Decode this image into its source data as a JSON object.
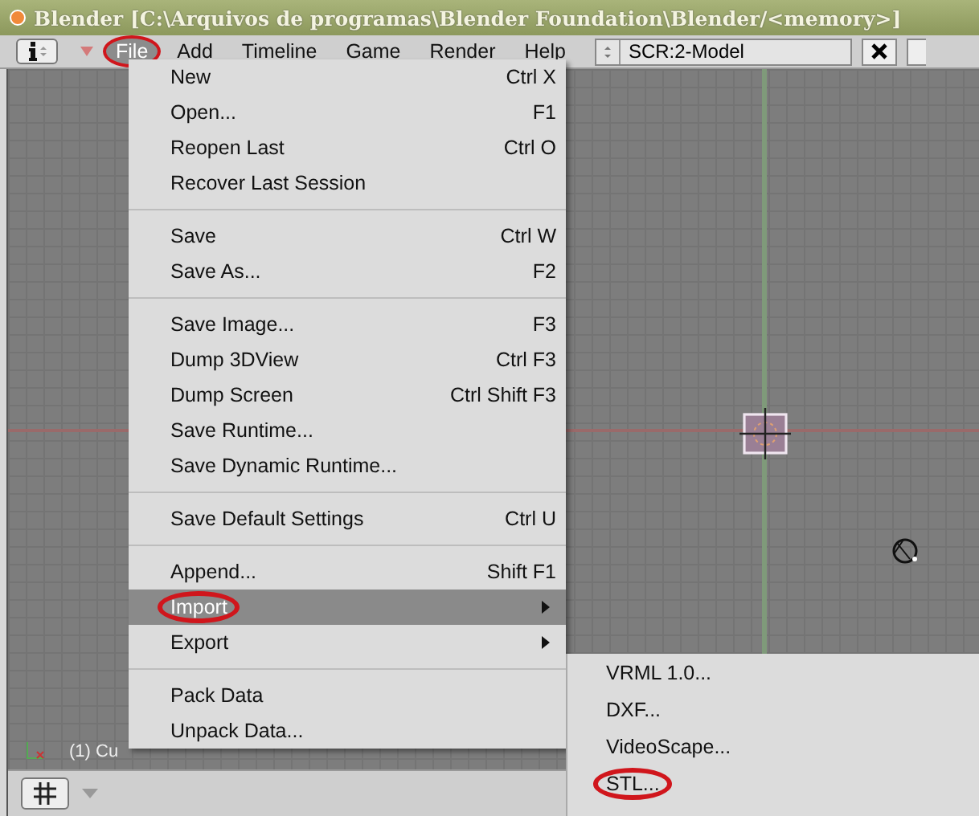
{
  "window": {
    "title": "Blender [C:\\Arquivos de programas\\Blender Foundation\\Blender/<memory>]"
  },
  "header": {
    "menus": [
      {
        "label": "File",
        "selected": true,
        "circled": true
      },
      {
        "label": "Add",
        "selected": false,
        "circled": false
      },
      {
        "label": "Timeline",
        "selected": false,
        "circled": false
      },
      {
        "label": "Game",
        "selected": false,
        "circled": false
      },
      {
        "label": "Render",
        "selected": false,
        "circled": false
      },
      {
        "label": "Help",
        "selected": false,
        "circled": false
      }
    ],
    "screen": "SCR:2-Model"
  },
  "viewport": {
    "object_label": "(1) Cu"
  },
  "file_menu": {
    "items": [
      {
        "kind": "item",
        "label": "New",
        "shortcut": "Ctrl X",
        "selected": false,
        "circled": false
      },
      {
        "kind": "item",
        "label": "Open...",
        "shortcut": "F1",
        "selected": false,
        "circled": false
      },
      {
        "kind": "item",
        "label": "Reopen Last",
        "shortcut": "Ctrl O",
        "selected": false,
        "circled": false
      },
      {
        "kind": "item",
        "label": "Recover Last Session",
        "selected": false,
        "circled": false
      },
      {
        "kind": "separator"
      },
      {
        "kind": "item",
        "label": "Save",
        "shortcut": "Ctrl W",
        "selected": false,
        "circled": false
      },
      {
        "kind": "item",
        "label": "Save As...",
        "shortcut": "F2",
        "selected": false,
        "circled": false
      },
      {
        "kind": "separator"
      },
      {
        "kind": "item",
        "label": "Save Image...",
        "shortcut": "F3",
        "selected": false,
        "circled": false
      },
      {
        "kind": "item",
        "label": "Dump 3DView",
        "shortcut": "Ctrl F3",
        "selected": false,
        "circled": false
      },
      {
        "kind": "item",
        "label": "Dump Screen",
        "shortcut": "Ctrl Shift F3",
        "selected": false,
        "circled": false
      },
      {
        "kind": "item",
        "label": "Save Runtime...",
        "selected": false,
        "circled": false
      },
      {
        "kind": "item",
        "label": "Save Dynamic Runtime...",
        "selected": false,
        "circled": false
      },
      {
        "kind": "separator"
      },
      {
        "kind": "item",
        "label": "Save Default Settings",
        "shortcut": "Ctrl U",
        "selected": false,
        "circled": false
      },
      {
        "kind": "separator"
      },
      {
        "kind": "item",
        "label": "Append...",
        "shortcut": "Shift F1",
        "selected": false,
        "circled": false
      },
      {
        "kind": "submenu",
        "label": "Import",
        "selected": true,
        "circled": true
      },
      {
        "kind": "submenu",
        "label": "Export",
        "selected": false,
        "circled": false
      },
      {
        "kind": "separator"
      },
      {
        "kind": "item",
        "label": "Pack Data",
        "selected": false,
        "circled": false
      },
      {
        "kind": "item",
        "label": "Unpack Data...",
        "selected": false,
        "circled": false
      }
    ]
  },
  "import_submenu": {
    "items": [
      {
        "label": "VRML 1.0...",
        "selected": false,
        "circled": false
      },
      {
        "label": "DXF...",
        "selected": false,
        "circled": false
      },
      {
        "label": "VideoScape...",
        "selected": false,
        "circled": false
      },
      {
        "label": "STL...",
        "selected": false,
        "circled": true
      }
    ]
  }
}
